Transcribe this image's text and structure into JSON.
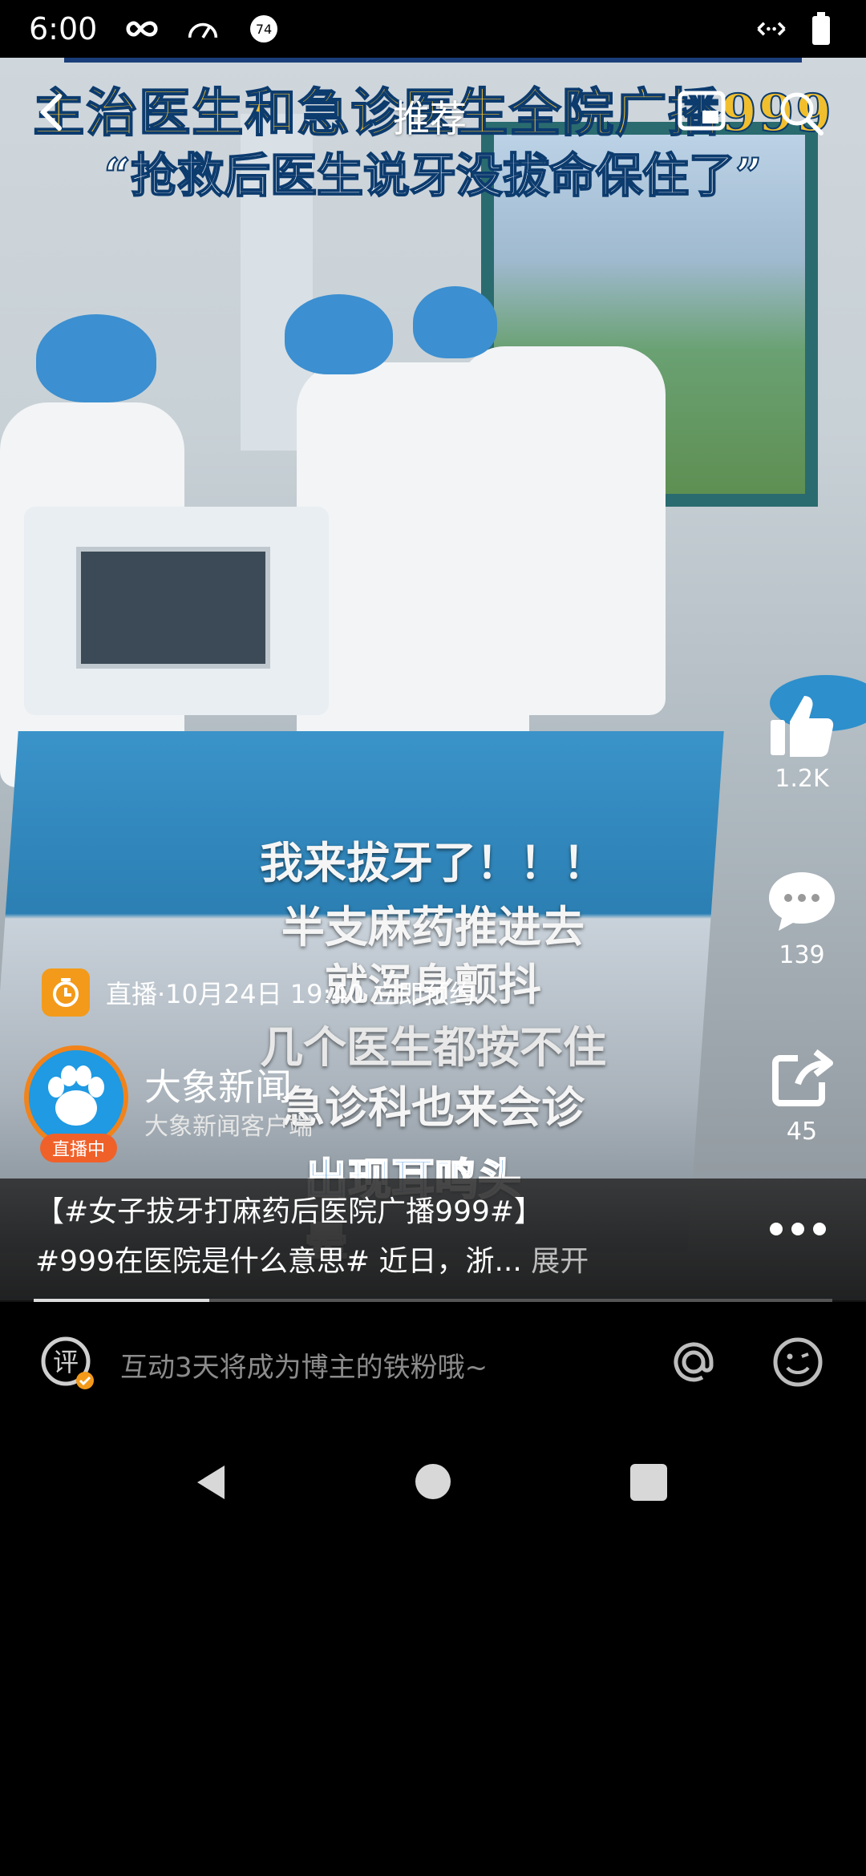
{
  "status_bar": {
    "time": "6:00",
    "badge_number": "74"
  },
  "top_nav": {
    "title": "推荐"
  },
  "video": {
    "headline_top": "主治医生和急诊医生全院广播999",
    "headline_bottom": "“抢救后医生说牙没拔命保住了”",
    "subtitles": [
      "我来拔牙了！！！",
      "半支麻药推进去",
      "就浑身颤抖",
      "几个医生都按不住",
      "急诊科也来会诊",
      "出现耳鸣头晕"
    ]
  },
  "side_actions": {
    "likes": "1.2K",
    "comments": "139",
    "shares": "45"
  },
  "live_reserve": {
    "text": "直播·10月24日 19:40  立即预约"
  },
  "author": {
    "name": "大象新闻",
    "subtitle": "大象新闻客户端",
    "live_label": "直播中"
  },
  "description": {
    "line1": "【#女子拔牙打麻药后医院广播999#】",
    "line2_tag": "#999在医院是什么意思#",
    "line2_text": " 近日，浙...",
    "expand": "展开",
    "progress": 0.22
  },
  "comment_bar": {
    "logo_char": "评",
    "placeholder": "互动3天将成为博主的铁粉哦~"
  },
  "colors": {
    "accent_orange": "#f39a1a",
    "live_red": "#f0612a",
    "avatar_blue": "#1f9ae3",
    "headline_yellow": "#f1bf2e"
  }
}
